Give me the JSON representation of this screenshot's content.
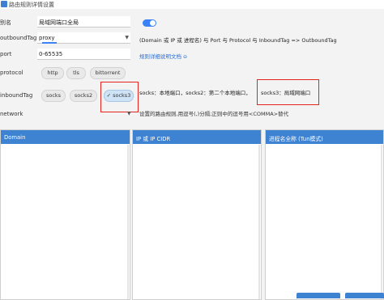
{
  "window": {
    "title": "路由规则详情设置"
  },
  "labels": {
    "alias": "别名",
    "outbound_tag": "outboundTag",
    "port": "port",
    "protocol": "protocol",
    "inbound_tag": "inboundTag",
    "network": "network"
  },
  "fields": {
    "alias_value": "局域网端口全局",
    "outbound_value": "proxy",
    "port_value": "0-65535"
  },
  "toggle": {
    "enabled": true
  },
  "help_text": "(Domain 或 IP 或 进程名) 与 Port 与 Protocol 与 InboundTag => OutboundTag",
  "doc_link": "规则详细说明文档",
  "protocol_chips": [
    "http",
    "tls",
    "bittorrent"
  ],
  "inbound_chips": [
    "socks",
    "socks2",
    "socks3"
  ],
  "inbound_selected": "socks3",
  "inbound_help": "socks：本地端口，socks2：第二个本地端口，",
  "inbound_help_socks3": "socks3：局域网端口",
  "network_note": "设置的路由规则,用逗号(,)分隔;正则中的逗号用<COMMA>替代",
  "panels": {
    "domain": "Domain",
    "ip": "IP 或 IP CIDR",
    "process": "进程名全称 (Tun模式)"
  },
  "colors": {
    "accent": "#3e82d2",
    "highlight": "#e2241a",
    "link": "#2b6fd6"
  },
  "icons": {
    "app": "app-icon",
    "link": "link-icon",
    "dropdown": "chevron-down-icon",
    "check": "check-icon"
  }
}
